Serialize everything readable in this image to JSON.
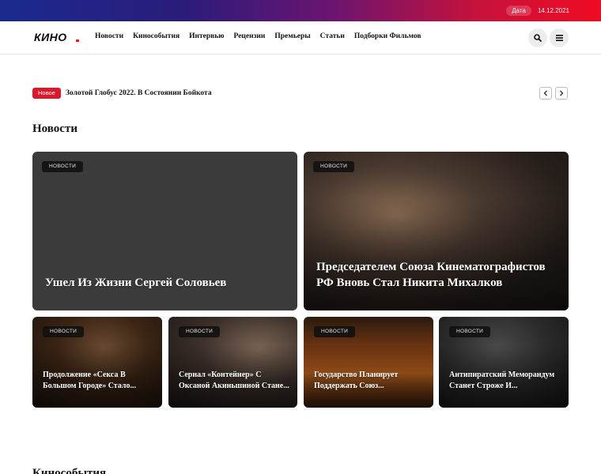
{
  "topbar": {
    "date_label": "Дата",
    "date_value": "14.12.2021"
  },
  "logo": {
    "text": "КИНО"
  },
  "nav": {
    "items": [
      {
        "label": "Новости"
      },
      {
        "label": "Кинособытия"
      },
      {
        "label": "Интервью"
      },
      {
        "label": "Рецензии"
      },
      {
        "label": "Премьеры"
      },
      {
        "label": "Статьи"
      },
      {
        "label": "Подборки Фильмов"
      }
    ]
  },
  "icons": {
    "search": "search-icon",
    "menu": "hamburger-icon",
    "prev": "chevron-left-icon",
    "next": "chevron-right-icon"
  },
  "ticker": {
    "badge": "Новое",
    "headline": "Золотой Глобус 2022. В Состоянии Бойкота"
  },
  "sections": {
    "news_title": "Новости",
    "events_title": "Кинособытия"
  },
  "cards": [
    {
      "category": "НОВОСТИ",
      "title": "Ушел Из Жизни Сергей Соловьев"
    },
    {
      "category": "НОВОСТИ",
      "title": "Председателем Союза Кинематографистов РФ Вновь Стал Никита Михалков"
    },
    {
      "category": "НОВОСТИ",
      "title": "Продолжение «Секса В Большом Городе» Стало..."
    },
    {
      "category": "НОВОСТИ",
      "title": "Сериал «Контейнер» С Оксаной Акиньшиной Стане..."
    },
    {
      "category": "НОВОСТИ",
      "title": "Государство Планирует Поддержать Союз..."
    },
    {
      "category": "НОВОСТИ",
      "title": "Антипиратский Меморандум Станет Строже И..."
    }
  ],
  "colors": {
    "accent": "#d8192b",
    "topbar_start": "#1b2a8f",
    "topbar_end": "#f00a22"
  }
}
